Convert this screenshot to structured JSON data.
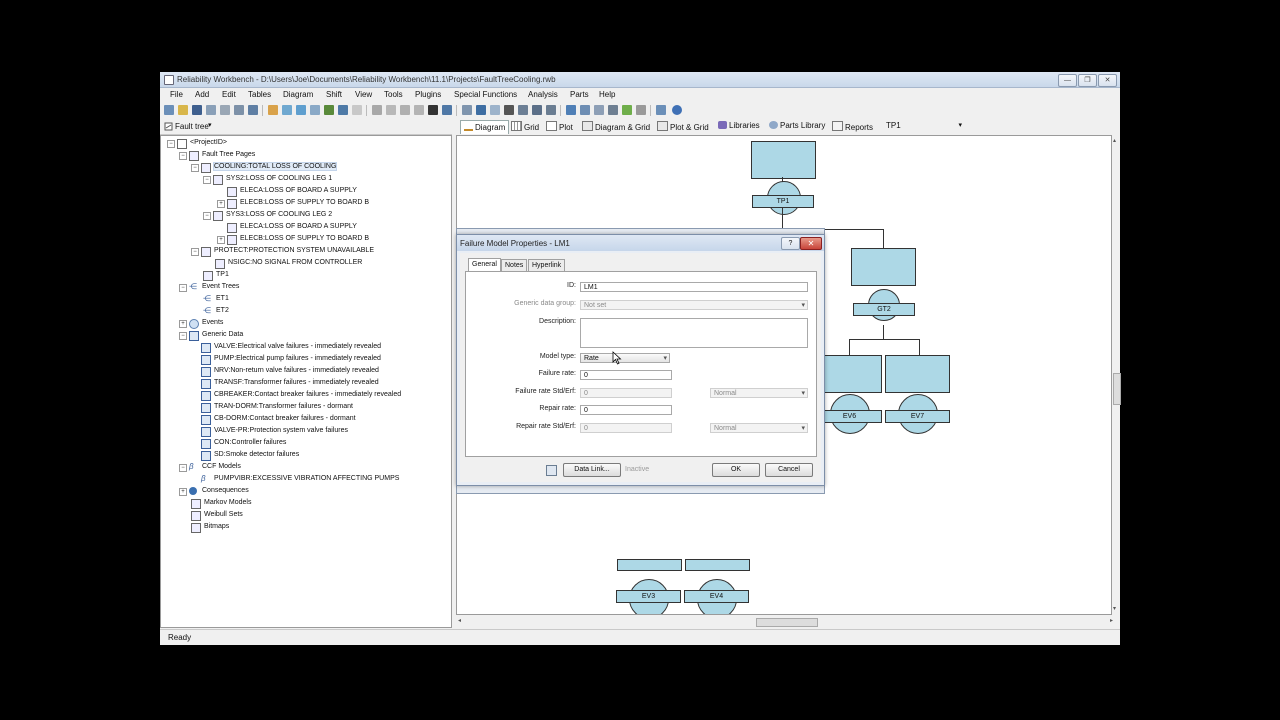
{
  "window": {
    "title": "Reliability Workbench - D:\\Users\\Joe\\Documents\\Reliability Workbench\\11.1\\Projects\\FaultTreeCooling.rwb",
    "min_glyph": "—",
    "max_glyph": "❐",
    "close_glyph": "✕"
  },
  "menu": [
    "File",
    "Add",
    "Edit",
    "Tables",
    "Diagram",
    "Shift",
    "View",
    "Tools",
    "Plugins",
    "Special Functions",
    "Analysis",
    "Parts",
    "Help"
  ],
  "tree": {
    "selector_label": "Fault tree",
    "nodes": [
      {
        "label": "<ProjectID>"
      },
      {
        "label": "Fault Tree Pages"
      },
      {
        "label": "COOLING:TOTAL LOSS OF COOLING"
      },
      {
        "label": "SYS2:LOSS OF COOLING LEG 1"
      },
      {
        "label": "ELECA:LOSS OF BOARD A SUPPLY"
      },
      {
        "label": "ELECB:LOSS OF SUPPLY TO BOARD B"
      },
      {
        "label": "SYS3:LOSS OF COOLING LEG 2"
      },
      {
        "label": "ELECA:LOSS OF BOARD A SUPPLY"
      },
      {
        "label": "ELECB:LOSS OF SUPPLY TO BOARD B"
      },
      {
        "label": "PROTECT:PROTECTION SYSTEM UNAVAILABLE"
      },
      {
        "label": "NSIGC:NO SIGNAL FROM CONTROLLER"
      },
      {
        "label": "TP1"
      },
      {
        "label": "Event Trees"
      },
      {
        "label": "ET1"
      },
      {
        "label": "ET2"
      },
      {
        "label": "Events"
      },
      {
        "label": "Generic Data"
      },
      {
        "label": "VALVE:Electrical valve failures - immediately revealed"
      },
      {
        "label": "PUMP:Electrical pump failures - immediately revealed"
      },
      {
        "label": "NRV:Non-return valve failures - immediately revealed"
      },
      {
        "label": "TRANSF:Transformer failures - immediately revealed"
      },
      {
        "label": "CBREAKER:Contact breaker failures - immediately revealed"
      },
      {
        "label": "TRAN-DORM:Transformer failures - dormant"
      },
      {
        "label": "CB-DORM:Contact breaker failures - dormant"
      },
      {
        "label": "VALVE-PR:Protection system valve failures"
      },
      {
        "label": "CON:Controller failures"
      },
      {
        "label": "SD:Smoke detector failures"
      },
      {
        "label": "CCF Models"
      },
      {
        "label": "PUMPVIBR:EXCESSIVE VIBRATION AFFECTING PUMPS"
      },
      {
        "label": "Consequences"
      },
      {
        "label": "Markov Models"
      },
      {
        "label": "Weibull Sets"
      },
      {
        "label": "Bitmaps"
      }
    ]
  },
  "view_tabs": [
    {
      "label": "Diagram"
    },
    {
      "label": "Grid"
    },
    {
      "label": "Plot"
    },
    {
      "label": "Diagram & Grid"
    },
    {
      "label": "Plot & Grid"
    },
    {
      "label": "Libraries"
    },
    {
      "label": "Parts Library"
    },
    {
      "label": "Reports"
    }
  ],
  "page_selector": "TP1",
  "diagram": {
    "gate_labels": [
      "TP1",
      "GT2"
    ],
    "event_labels": [
      "EV6",
      "EV7",
      "EV3",
      "EV4"
    ]
  },
  "dialog": {
    "title": "Failure Model Properties - LM1",
    "help_glyph": "?",
    "close_glyph": "✕",
    "tabs": [
      "General",
      "Notes",
      "Hyperlink"
    ],
    "fields": {
      "id_label": "ID:",
      "id_value": "LM1",
      "generic_label": "Generic data group:",
      "generic_value": "Not set",
      "description_label": "Description:",
      "description_value": "",
      "model_type_label": "Model type:",
      "model_type_value": "Rate",
      "failure_rate_label": "Failure rate:",
      "failure_rate_value": "0",
      "failure_rate_std_label": "Failure rate Std/Erf:",
      "failure_rate_std_value": "0",
      "failure_rate_dist": "Normal",
      "repair_rate_label": "Repair rate:",
      "repair_rate_value": "0",
      "repair_rate_std_label": "Repair rate Std/Erf:",
      "repair_rate_std_value": "0",
      "repair_rate_dist": "Normal"
    },
    "data_link_label": "Data Link...",
    "inactive_label": "Inactive",
    "ok_label": "OK",
    "cancel_label": "Cancel"
  },
  "status": "Ready"
}
